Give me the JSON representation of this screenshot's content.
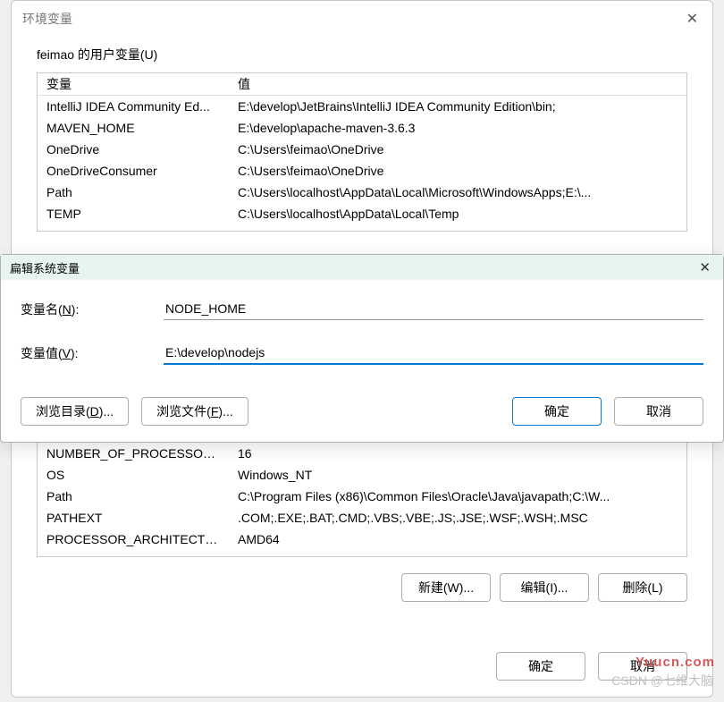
{
  "window": {
    "title": "环境变量",
    "close_symbol": "✕"
  },
  "user_vars": {
    "heading": "feimao 的用户变量(U)",
    "columns": {
      "name": "变量",
      "value": "值"
    },
    "rows": [
      {
        "name": "IntelliJ IDEA Community Ed...",
        "value": "E:\\develop\\JetBrains\\IntelliJ IDEA Community Edition\\bin;"
      },
      {
        "name": "MAVEN_HOME",
        "value": "E:\\develop\\apache-maven-3.6.3"
      },
      {
        "name": "OneDrive",
        "value": "C:\\Users\\feimao\\OneDrive"
      },
      {
        "name": "OneDriveConsumer",
        "value": "C:\\Users\\feimao\\OneDrive"
      },
      {
        "name": "Path",
        "value": "C:\\Users\\localhost\\AppData\\Local\\Microsoft\\WindowsApps;E:\\..."
      },
      {
        "name": "TEMP",
        "value": "C:\\Users\\localhost\\AppData\\Local\\Temp"
      }
    ]
  },
  "sys_vars": {
    "rows": [
      {
        "name": "NUMBER_OF_PROCESSORS",
        "value": "16"
      },
      {
        "name": "OS",
        "value": "Windows_NT"
      },
      {
        "name": "Path",
        "value": "C:\\Program Files (x86)\\Common Files\\Oracle\\Java\\javapath;C:\\W..."
      },
      {
        "name": "PATHEXT",
        "value": ".COM;.EXE;.BAT;.CMD;.VBS;.VBE;.JS;.JSE;.WSF;.WSH;.MSC"
      },
      {
        "name": "PROCESSOR_ARCHITECTURE",
        "value": "AMD64"
      }
    ],
    "buttons": {
      "new": "新建(W)...",
      "edit": "编辑(I)...",
      "delete": "删除(L)"
    }
  },
  "dialog": {
    "title": "扁辑系统变量",
    "close_symbol": "✕",
    "name_label_pre": "变量名(",
    "name_label_key": "N",
    "name_label_post": "):",
    "name_value": "NODE_HOME",
    "value_label_pre": "变量值(",
    "value_label_key": "V",
    "value_label_post": "):",
    "value_value": "E:\\develop\\nodejs",
    "buttons": {
      "browse_dir_pre": "浏览目录(",
      "browse_dir_key": "D",
      "browse_dir_post": ")...",
      "browse_file_pre": "浏览文件(",
      "browse_file_key": "F",
      "browse_file_post": ")...",
      "ok": "确定",
      "cancel": "取消"
    }
  },
  "main_footer": {
    "ok": "确定",
    "cancel": "取消"
  },
  "watermarks": {
    "w1": "Yuucn.com",
    "w2": "CSDN @七维大脑"
  }
}
